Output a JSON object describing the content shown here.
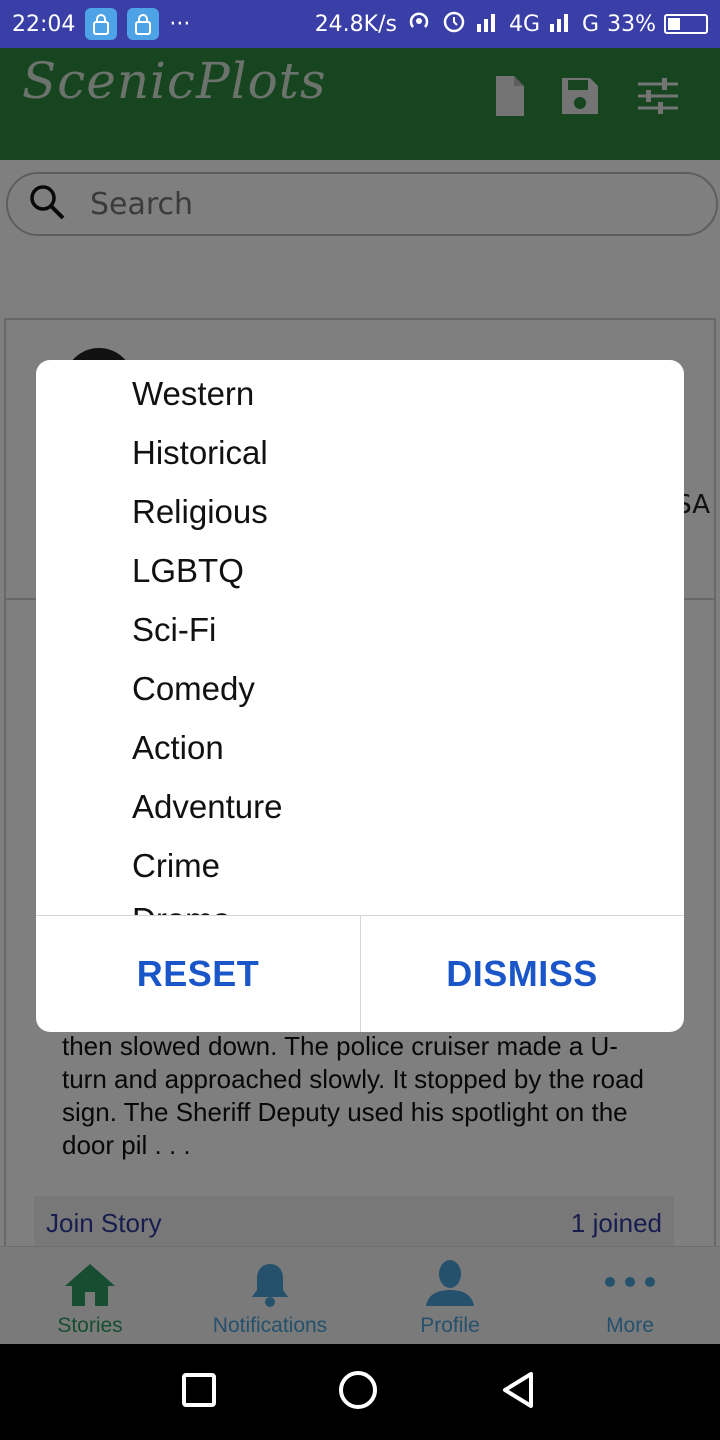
{
  "status_bar": {
    "time": "22:04",
    "more": "···",
    "speed": "24.8K/s",
    "network_1": "4G",
    "network_2": "G",
    "battery": "33%",
    "battery_level": 0.33
  },
  "app_bar": {
    "logo": "ScenicPlots",
    "icons": [
      "document-icon",
      "save-icon",
      "filter-sliders-icon"
    ]
  },
  "search": {
    "placeholder": "Search"
  },
  "card": {
    "partial_text": "SA"
  },
  "story": {
    "excerpt": "then slowed down. The police cruiser made a U-turn and approached slowly. It stopped by the road sign. The Sheriff Deputy used his spotlight on the door pil . . .",
    "join_label": "Join Story",
    "joined_count": "1 joined"
  },
  "dialog": {
    "genres": [
      "Western",
      "Historical",
      "Religious",
      "LGBTQ",
      "Sci-Fi",
      "Comedy",
      "Action",
      "Adventure",
      "Crime",
      "Drama"
    ],
    "reset_label": "RESET",
    "dismiss_label": "DISMISS"
  },
  "bottom_nav": {
    "items": [
      {
        "label": "Stories",
        "icon": "home-icon",
        "active": true
      },
      {
        "label": "Notifications",
        "icon": "bell-icon",
        "active": false
      },
      {
        "label": "Profile",
        "icon": "person-icon",
        "active": false
      },
      {
        "label": "More",
        "icon": "more-dots-icon",
        "active": false
      }
    ]
  },
  "colors": {
    "status_bar": "#3a3fa8",
    "app_bar": "#2d8a3e",
    "accent_blue": "#1a56c7",
    "nav_active": "#2e9a62",
    "nav_inactive": "#4aa3d8"
  }
}
